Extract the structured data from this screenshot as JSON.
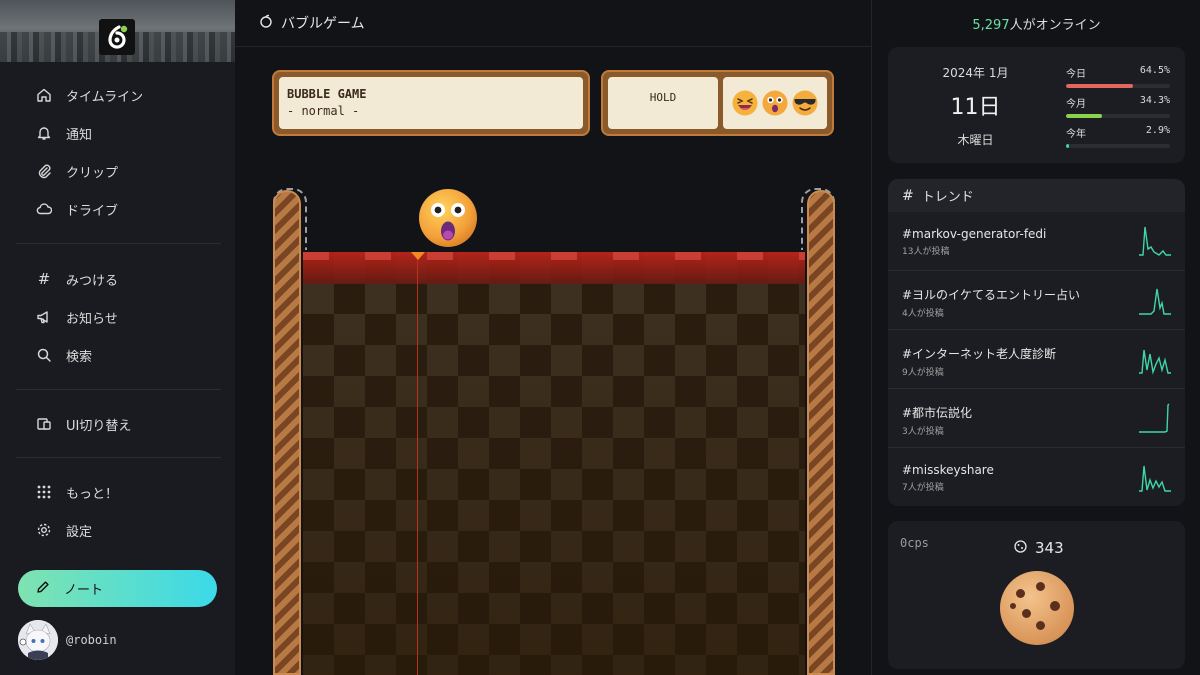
{
  "sidebar": {
    "nav_top": [
      {
        "label": "タイムライン",
        "icon": "home-icon"
      },
      {
        "label": "通知",
        "icon": "bell-icon"
      },
      {
        "label": "クリップ",
        "icon": "paperclip-icon"
      },
      {
        "label": "ドライブ",
        "icon": "cloud-icon"
      }
    ],
    "nav_mid": [
      {
        "label": "みつける",
        "icon": "hash-icon"
      },
      {
        "label": "お知らせ",
        "icon": "megaphone-icon"
      },
      {
        "label": "検索",
        "icon": "search-icon"
      }
    ],
    "nav_ui": [
      {
        "label": "UI切り替え",
        "icon": "ui-switch-icon"
      }
    ],
    "nav_bottom": [
      {
        "label": "もっと！",
        "icon": "grid-dots-icon"
      },
      {
        "label": "設定",
        "icon": "gear-icon"
      }
    ],
    "note_button": "ノート",
    "user_handle": "@roboin"
  },
  "main": {
    "header_title": "バブルゲーム",
    "game_title": "BUBBLE GAME",
    "game_mode": "- normal -",
    "hold_label": "HOLD"
  },
  "right": {
    "online_count": "5,297",
    "online_suffix": "人がオンライン",
    "calendar": {
      "year_month": "2024年  1月",
      "day": "11日",
      "weekday": "木曜日",
      "stats": [
        {
          "label": "今日",
          "value": "64.5%",
          "fraction": 0.645,
          "color": "#e2675d"
        },
        {
          "label": "今月",
          "value": "34.3%",
          "fraction": 0.343,
          "color": "#8bd34d"
        },
        {
          "label": "今年",
          "value": "2.9%",
          "fraction": 0.029,
          "color": "#3fd7a6"
        }
      ]
    },
    "trend": {
      "title": "トレンド",
      "items": [
        {
          "tag": "#markov-generator-fedi",
          "count": "13人が投稿"
        },
        {
          "tag": "#ヨルのイケてるエントリー占い",
          "count": "4人が投稿"
        },
        {
          "tag": "#インターネット老人度診断",
          "count": "9人が投稿"
        },
        {
          "tag": "#都市伝説化",
          "count": "3人が投稿"
        },
        {
          "tag": "#misskeyshare",
          "count": "7人が投稿"
        }
      ]
    },
    "cookie": {
      "cps": "0cps",
      "count": "343"
    }
  },
  "colors": {
    "accent": "#86e3a8",
    "sparkline": "#3fd7a6"
  }
}
